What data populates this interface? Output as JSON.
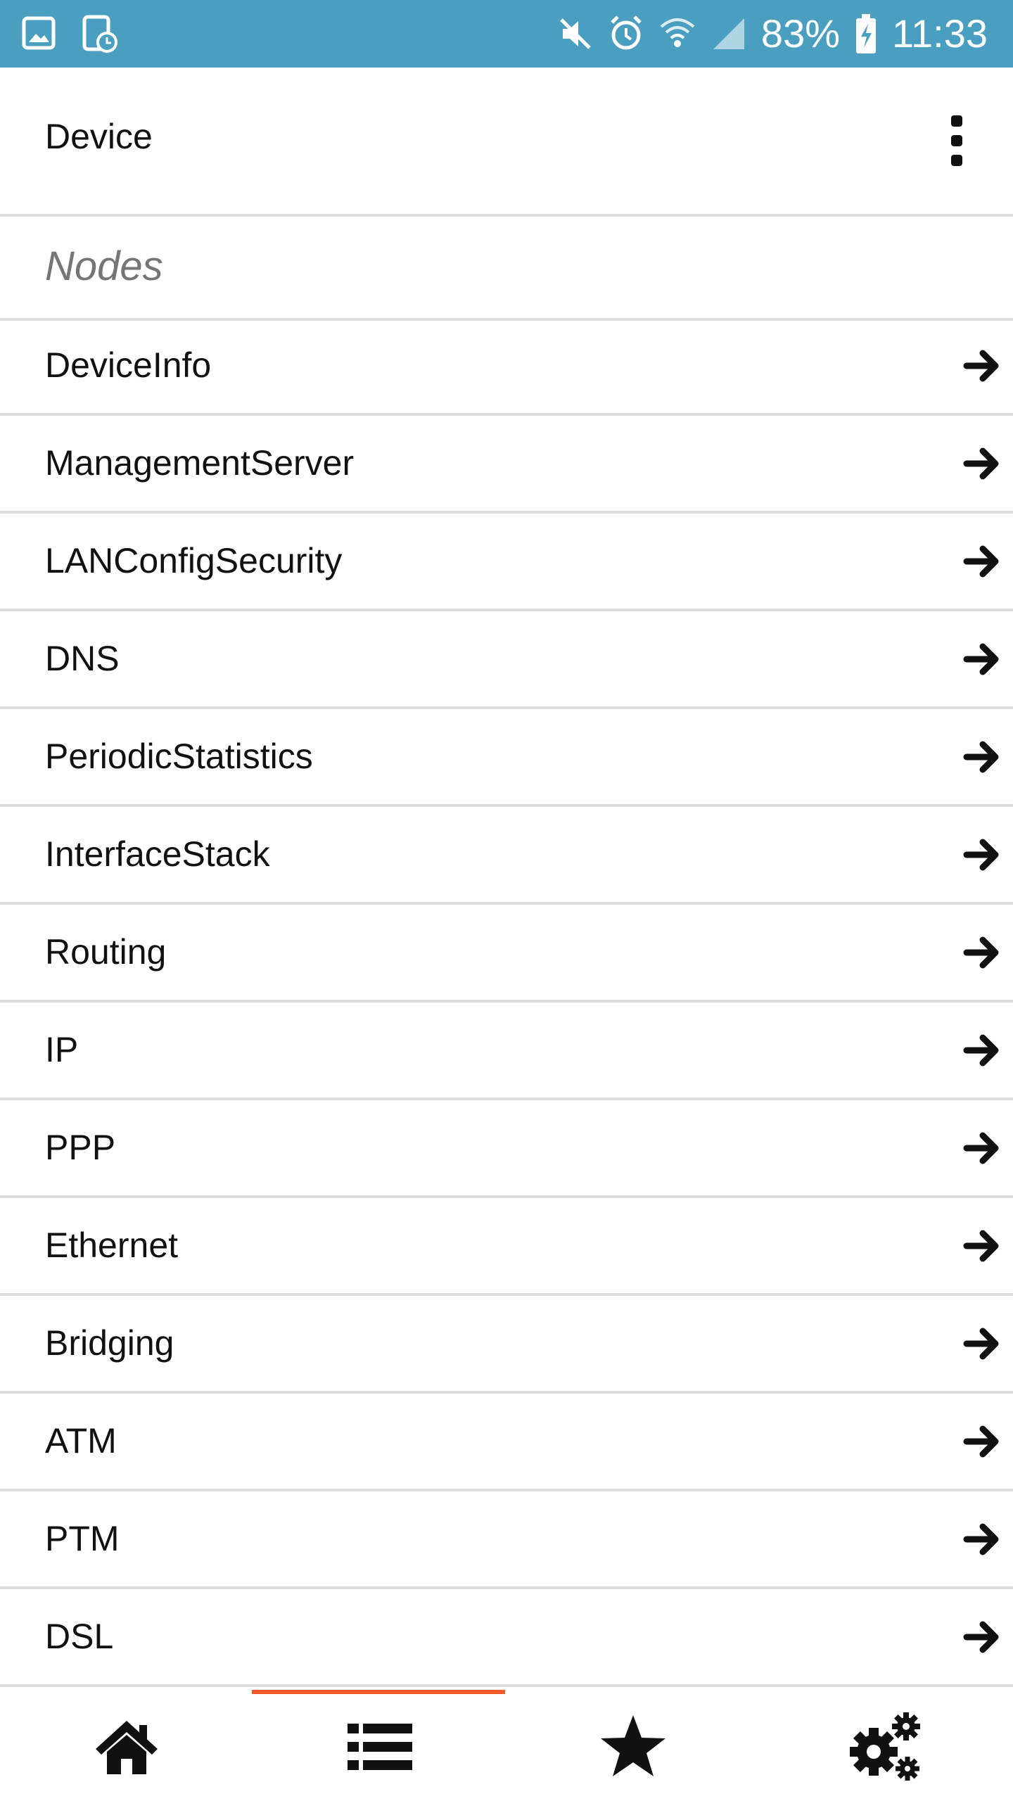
{
  "status_bar": {
    "left_icons": [
      "gallery-notification-icon",
      "screenshot-notification-icon"
    ],
    "right_icons": [
      "mute-icon",
      "alarm-icon",
      "wifi-icon",
      "signal-icon",
      "battery-charging-icon"
    ],
    "battery": "83%",
    "time": "11:33"
  },
  "header": {
    "title": "Device",
    "menu_icon": "more-vertical-icon"
  },
  "section": {
    "title": "Nodes"
  },
  "nodes": [
    {
      "label": "DeviceInfo"
    },
    {
      "label": "ManagementServer"
    },
    {
      "label": "LANConfigSecurity"
    },
    {
      "label": "DNS"
    },
    {
      "label": "PeriodicStatistics"
    },
    {
      "label": "InterfaceStack"
    },
    {
      "label": "Routing"
    },
    {
      "label": "IP"
    },
    {
      "label": "PPP"
    },
    {
      "label": "Ethernet"
    },
    {
      "label": "Bridging"
    },
    {
      "label": "ATM"
    },
    {
      "label": "PTM"
    },
    {
      "label": "DSL"
    }
  ],
  "bottom_nav": {
    "items": [
      {
        "icon": "home-icon",
        "active": false
      },
      {
        "icon": "list-icon",
        "active": true
      },
      {
        "icon": "star-icon",
        "active": false
      },
      {
        "icon": "settings-gears-icon",
        "active": false
      }
    ],
    "accent_color": "#f05a28"
  },
  "colors": {
    "status_bar": "#4a9fc0",
    "divider": "#dcdcdc",
    "section_text": "#757575"
  }
}
